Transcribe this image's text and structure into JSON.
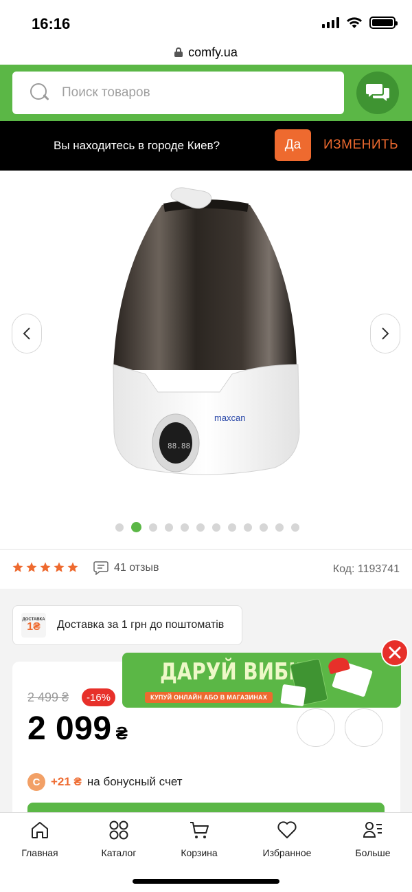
{
  "status_bar": {
    "time": "16:16"
  },
  "browser": {
    "url": "comfy.ua"
  },
  "header": {
    "search_placeholder": "Поиск товаров",
    "brand_color": "#5bb746"
  },
  "city_bar": {
    "question": "Вы находитесь в городе Киев?",
    "yes_label": "Да",
    "change_label": "ИЗМЕНИТЬ",
    "accent_color": "#ee6a2f"
  },
  "gallery": {
    "product_brand_label": "maxcan",
    "display_readout": "88.88",
    "slide_count": 12,
    "active_slide": 2,
    "prev_icon": "chevron-left-icon",
    "next_icon": "chevron-right-icon"
  },
  "rating": {
    "stars": 5,
    "reviews_label": "41 отзыв",
    "code_label": "Код: 1193741"
  },
  "delivery": {
    "badge_top": "ДОСТАВКА",
    "badge_price": "1₴",
    "text": "Доставка за 1 грн до поштоматів"
  },
  "price": {
    "old_price": "2 499 ₴",
    "discount": "-16%",
    "current": "2 099",
    "currency": "₴"
  },
  "bonus": {
    "icon_letter": "C",
    "amount": "+21 ₴",
    "text": "на бонусный счет"
  },
  "promo": {
    "title": "ДАРУЙ ВИБІР",
    "subtitle": "КУПУЙ ОНЛАЙН АБО В МАГАЗИНАХ"
  },
  "bottom_nav": [
    {
      "label": "Главная",
      "icon": "home-icon"
    },
    {
      "label": "Каталог",
      "icon": "catalog-icon"
    },
    {
      "label": "Корзина",
      "icon": "cart-icon"
    },
    {
      "label": "Избранное",
      "icon": "heart-icon"
    },
    {
      "label": "Больше",
      "icon": "more-icon"
    }
  ]
}
